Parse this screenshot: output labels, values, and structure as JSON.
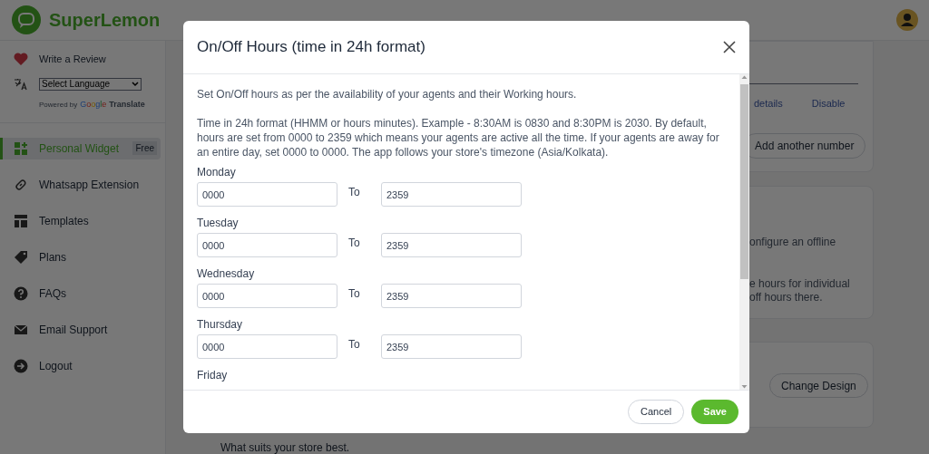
{
  "header": {
    "brand": "SuperLemon"
  },
  "sidebar": {
    "review": "Write a Review",
    "language_select": "Select Language",
    "powered_by": "Powered by",
    "google": "Google",
    "translate": "Translate",
    "items": [
      {
        "label": "Personal Widget",
        "badge": "Free",
        "selected": true
      },
      {
        "label": "Whatsapp Extension",
        "selected": false
      },
      {
        "label": "Templates",
        "selected": false
      },
      {
        "label": "Plans",
        "selected": false
      },
      {
        "label": "FAQs",
        "selected": false
      },
      {
        "label": "Email Support",
        "selected": false
      },
      {
        "label": "Logout",
        "selected": false
      }
    ]
  },
  "background": {
    "links": [
      "details",
      "Disable"
    ],
    "add_button": "Add another number",
    "offline_texts": [
      "onfigure an offline",
      "e hours for individual",
      "off hours there."
    ],
    "design_button": "Change Design",
    "left_text": "What suits your store best."
  },
  "dialog": {
    "title": "On/Off Hours (time in 24h format)",
    "intro": "Set On/Off hours as per the availability of your agents and their Working hours.",
    "help": "Time in 24h format (HHMM or hours minutes). Example - 8:30AM is 0830 and 8:30PM is 2030. By default, hours are set from 0000 to 2359 which means your agents are active all the time. If your agents are away for an entire day, set 0000 to 0000. The app follows your store's timezone (Asia/Kolkata).",
    "days": [
      {
        "day": "Monday",
        "from": "0000",
        "separator": "To",
        "to": "2359"
      },
      {
        "day": "Tuesday",
        "from": "0000",
        "separator": "To",
        "to": "2359"
      },
      {
        "day": "Wednesday",
        "from": "0000",
        "separator": "To",
        "to": "2359"
      },
      {
        "day": "Thursday",
        "from": "0000",
        "separator": "To",
        "to": "2359"
      }
    ],
    "cut_day": "Friday",
    "buttons": {
      "cancel": "Cancel",
      "save": "Save"
    }
  }
}
